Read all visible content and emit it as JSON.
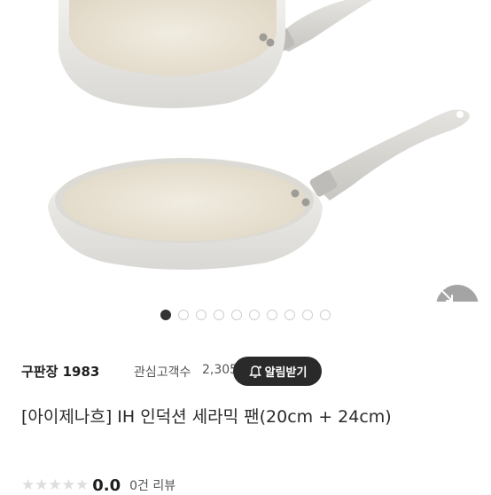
{
  "gallery": {
    "slide_count": 10,
    "active_index": 0,
    "expand_icon": "expand-arrows-icon",
    "colors": {
      "pan_body": "#ebeae6",
      "pan_inner": "#e9e2d3",
      "handle": "#d8d6d1"
    }
  },
  "shop": {
    "name": "구판장 1983",
    "fav_label": "관심고객수",
    "fav_count": "2,305",
    "alarm_label": "알림받기",
    "alarm_icon": "bell-plus-icon"
  },
  "product": {
    "title": "[아이제나흐] IH 인덕션 세라믹 팬(20cm + 24cm)"
  },
  "review": {
    "stars_filled": 0,
    "stars_total": 5,
    "score": "0.0",
    "count_label": "0건 리뷰"
  }
}
